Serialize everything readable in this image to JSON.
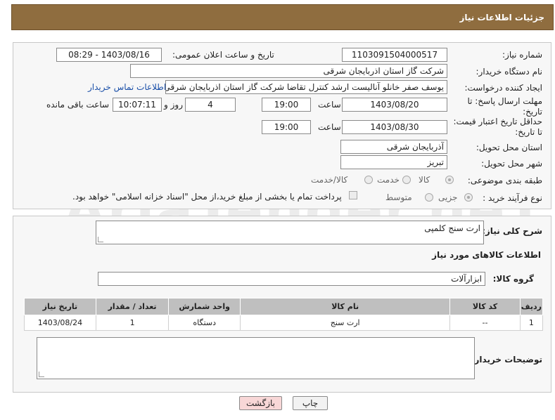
{
  "header": {
    "title": "جزئیات اطلاعات نیاز"
  },
  "form": {
    "need_number_label": "شماره نیاز:",
    "need_number": "1103091504000517",
    "announce_label": "تاریخ و ساعت اعلان عمومی:",
    "announce_value": "1403/08/16 - 08:29",
    "buyer_label": "نام دستگاه خریدار:",
    "buyer_value": "شرکت گاز استان اذربایجان شرقی",
    "creator_label": "ایجاد کننده درخواست:",
    "creator_value": "یوسف صفر خانلو  آنالیست ارشد کنترل تقاضا  شرکت گاز استان اذربایجان شرقی",
    "contact_link": "اطلاعات تماس خریدار",
    "deadline_label": "مهلت ارسال پاسخ: تا تاریخ:",
    "deadline_date": "1403/08/20",
    "time_label": "ساعت",
    "deadline_time": "19:00",
    "days_value": "4",
    "days_label": "روز و",
    "remaining_time": "10:07:11",
    "remaining_label": "ساعت باقی مانده",
    "validity_label": "حداقل تاریخ اعتبار قیمت: تا تاریخ:",
    "validity_date": "1403/08/30",
    "validity_time": "19:00",
    "province_label": "استان محل تحویل:",
    "province_value": "آذربایجان شرقی",
    "city_label": "شهر محل تحویل:",
    "city_value": "تبریز",
    "category_label": "طبقه بندی موضوعی:",
    "category_options": [
      "کالا",
      "خدمت",
      "کالا/خدمت"
    ],
    "category_selected": "کالا",
    "process_label": "نوع فرآیند خرید :",
    "process_options": [
      "جزیی",
      "متوسط"
    ],
    "payment_note": "پرداخت تمام یا بخشی از مبلغ خرید،از محل \"اسناد خزانه اسلامی\" خواهد بود."
  },
  "details": {
    "summary_label": "شرح کلی نیاز:",
    "summary_value": "ارت سنج کلمپی",
    "goods_info_title": "اطلاعات کالاهای مورد نیاز",
    "group_label": "گروه کالا:",
    "group_value": "ابزارآلات"
  },
  "table": {
    "headers": [
      "ردیف",
      "کد کالا",
      "نام کالا",
      "واحد شمارش",
      "تعداد / مقدار",
      "تاریخ نیاز"
    ],
    "rows": [
      [
        "1",
        "--",
        "ارت سنج",
        "دستگاه",
        "1",
        "1403/08/24"
      ]
    ]
  },
  "buyer_notes": {
    "label": "توضیحات خریدار:"
  },
  "buttons": {
    "print": "چاپ",
    "back": "بازگشت"
  },
  "watermark": {
    "text": "AriaTender.neT"
  },
  "colors": {
    "header_bg": "#8f6d3f",
    "link": "#1a4fa8",
    "back_button": "#f8d7d7"
  }
}
